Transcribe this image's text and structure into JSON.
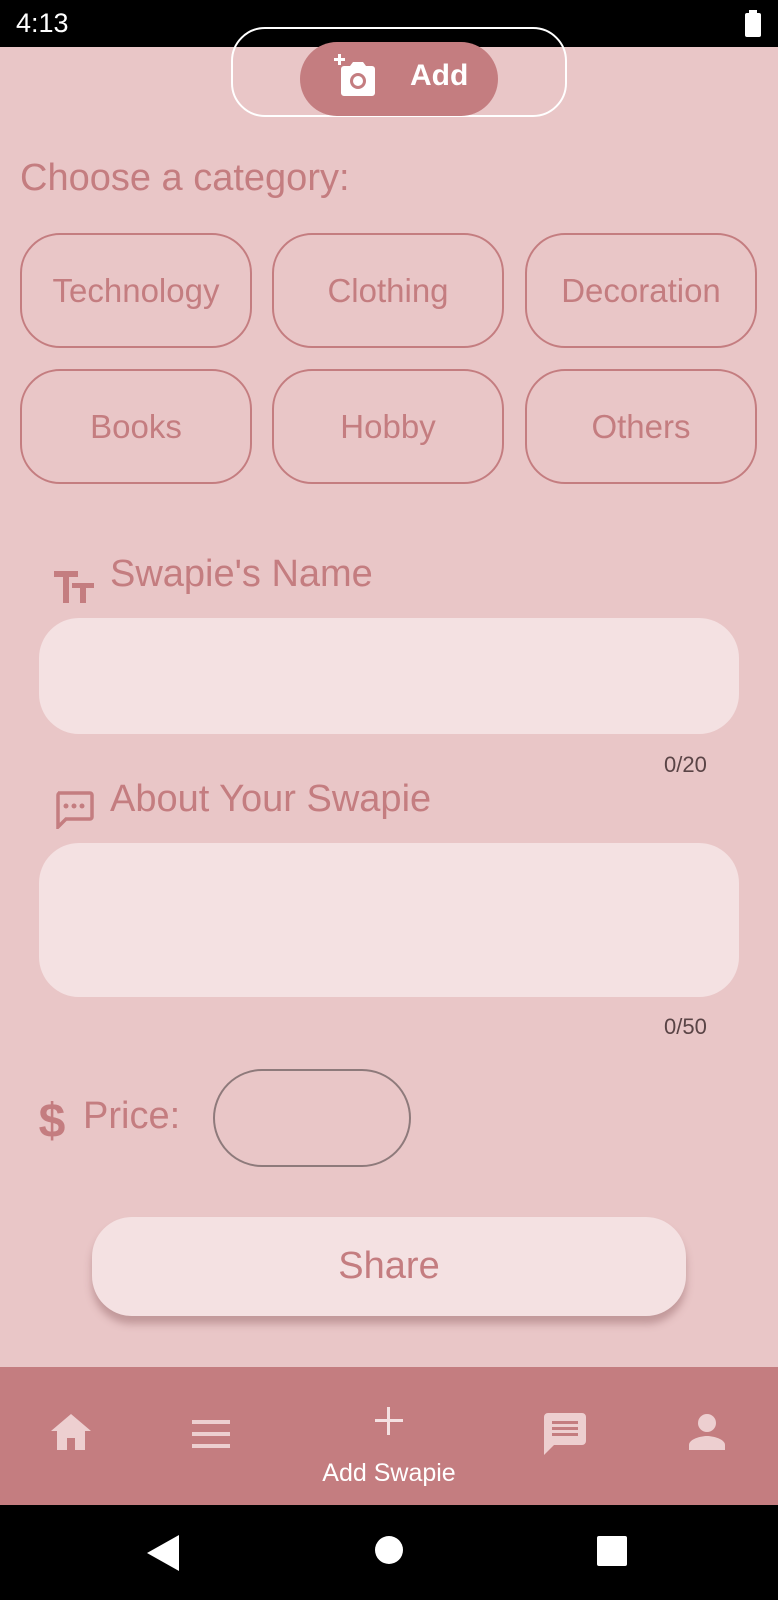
{
  "status_bar": {
    "time": "4:13"
  },
  "photo": {
    "add_label": "Add"
  },
  "category": {
    "title": "Choose a category:",
    "options": [
      "Technology",
      "Clothing",
      "Decoration",
      "Books",
      "Hobby",
      "Others"
    ]
  },
  "name_field": {
    "label": "Swapie's Name",
    "value": "",
    "counter": "0/20"
  },
  "about_field": {
    "label": "About Your Swapie",
    "value": "",
    "counter": "0/50"
  },
  "price": {
    "label": "Price:",
    "value": ""
  },
  "share_button": "Share",
  "bottom_nav": {
    "items": [
      {
        "icon": "home-icon",
        "label": ""
      },
      {
        "icon": "menu-icon",
        "label": ""
      },
      {
        "icon": "plus-icon",
        "label": "Add Swapie"
      },
      {
        "icon": "chat-icon",
        "label": ""
      },
      {
        "icon": "person-icon",
        "label": ""
      }
    ]
  },
  "colors": {
    "background": "#e9c6c7",
    "accent": "#c47d80",
    "field_fill": "#f4e1e2"
  }
}
